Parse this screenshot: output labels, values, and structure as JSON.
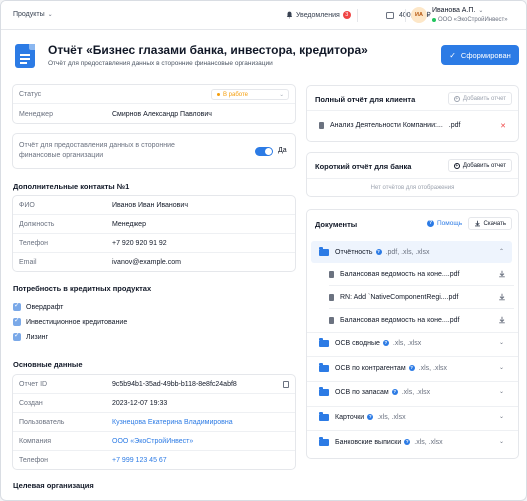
{
  "topbar": {
    "products_label": "Продукты",
    "notifications_label": "Уведомления",
    "notifications_count": "3",
    "balance": "400,000 ₽",
    "avatar_initials": "ИА",
    "user_name": "Иванова А.П.",
    "user_org": "ООО «ЭкоСтройИнвест»"
  },
  "header": {
    "title": "Отчёт «Бизнес глазами банка, инвестора, кредитора»",
    "subtitle": "Отчёт для предоставления данных в сторонние финансовые организации",
    "primary_button": "Сформирован"
  },
  "status_card": {
    "status_label": "Статус",
    "status_value": "В работе",
    "manager_label": "Менеджер",
    "manager_value": "Смирнов Александр Павлович"
  },
  "toggle_card": {
    "text": "Отчёт для предоставления данных в сторонние финансовые организации",
    "toggle_label": "Да",
    "enabled": true
  },
  "contacts": {
    "title": "Дополнительные контакты №1",
    "rows": [
      {
        "label": "ФИО",
        "value": "Иванов Иван Иванович"
      },
      {
        "label": "Должность",
        "value": "Менеджер"
      },
      {
        "label": "Телефон",
        "value": "+7 920 920 91 92"
      },
      {
        "label": "Email",
        "value": "ivanov@example.com"
      }
    ]
  },
  "credit_needs": {
    "title": "Потребность в кредитных продуктах",
    "items": [
      "Овердрафт",
      "Инвестиционное кредитование",
      "Лизинг"
    ]
  },
  "basic_data": {
    "title": "Основные данные",
    "rows": [
      {
        "label": "Отчет ID",
        "value": "9c5b94b1-35ad-49bb-b118-8e8fc24abf8"
      },
      {
        "label": "Создан",
        "value": "2023-12-07 19:33"
      },
      {
        "label": "Пользователь",
        "value": "Кузнецова Екатерина Владимировна"
      },
      {
        "label": "Компания",
        "value": "ООО «ЭкоСтройИнвест»"
      },
      {
        "label": "Телефон",
        "value": "+7 999 123 45 67"
      }
    ]
  },
  "target_org": {
    "title": "Целевая организация"
  },
  "full_report": {
    "title": "Полный отчёт для клиента",
    "add_button": "Добавить отчет",
    "file_name": "Анализ Деятельности Компании:...",
    "file_ext": ".pdf"
  },
  "short_report": {
    "title": "Короткий отчёт для банка",
    "add_button": "Добавить отчет",
    "empty_text": "Нет отчётов для отображения"
  },
  "documents": {
    "title": "Документы",
    "help_label": "Помощь",
    "download_label": "Скачать",
    "folders": [
      {
        "name": "Отчётность",
        "ext": ".pdf, .xls, .xlsx",
        "open": true,
        "files": [
          {
            "name": "Балансовая ведомость на коне...",
            "ext": ".pdf"
          },
          {
            "name": "RN: Add `NativeComponentRegi...",
            "ext": ".pdf"
          },
          {
            "name": "Балансовая ведомость на коне...",
            "ext": ".pdf"
          }
        ]
      },
      {
        "name": "ОСВ сводные",
        "ext": ".xls, .xlsx",
        "open": false
      },
      {
        "name": "ОСВ по контрагентам",
        "ext": ".xls, .xlsx",
        "open": false
      },
      {
        "name": "ОСВ по запасам",
        "ext": ".xls, .xlsx",
        "open": false
      },
      {
        "name": "Карточки",
        "ext": ".xls, .xlsx",
        "open": false
      },
      {
        "name": "Банковские выписки",
        "ext": ".xls, .xlsx",
        "open": false
      }
    ]
  },
  "colors": {
    "accent": "#2c7be5",
    "status_orange": "#f59e0b",
    "danger": "#ef4444",
    "success": "#22c55e"
  }
}
